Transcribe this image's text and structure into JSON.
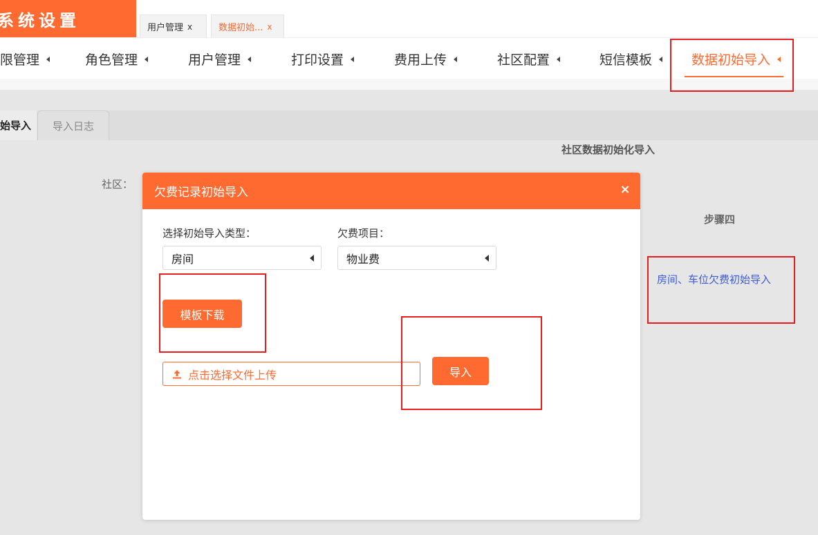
{
  "app": {
    "title": "系统设置"
  },
  "window_tabs": [
    {
      "label": "用户管理",
      "close": "x"
    },
    {
      "label": "数据初始...",
      "close": "x"
    }
  ],
  "menu": [
    {
      "label": "限管理"
    },
    {
      "label": "角色管理"
    },
    {
      "label": "用户管理"
    },
    {
      "label": "打印设置"
    },
    {
      "label": "费用上传"
    },
    {
      "label": "社区配置"
    },
    {
      "label": "短信模板"
    },
    {
      "label": "数据初始导入"
    }
  ],
  "subtabs": [
    {
      "label": "始导入"
    },
    {
      "label": "导入日志"
    }
  ],
  "page": {
    "title": "社区数据初始化导入",
    "community_label": "社区：",
    "step_title": "步骤四",
    "step_link": "房间、车位欠费初始导入"
  },
  "modal": {
    "title": "欠费记录初始导入",
    "close_icon": "×",
    "type_label": "选择初始导入类型：",
    "type_value": "房间",
    "item_label": "欠费项目：",
    "item_value": "物业费",
    "template_button": "模板下载",
    "upload_label": "点击选择文件上传",
    "import_button": "导入"
  },
  "colors": {
    "accent": "#ff6a30",
    "highlight": "#e81c1c",
    "link": "#3d5bd8"
  }
}
